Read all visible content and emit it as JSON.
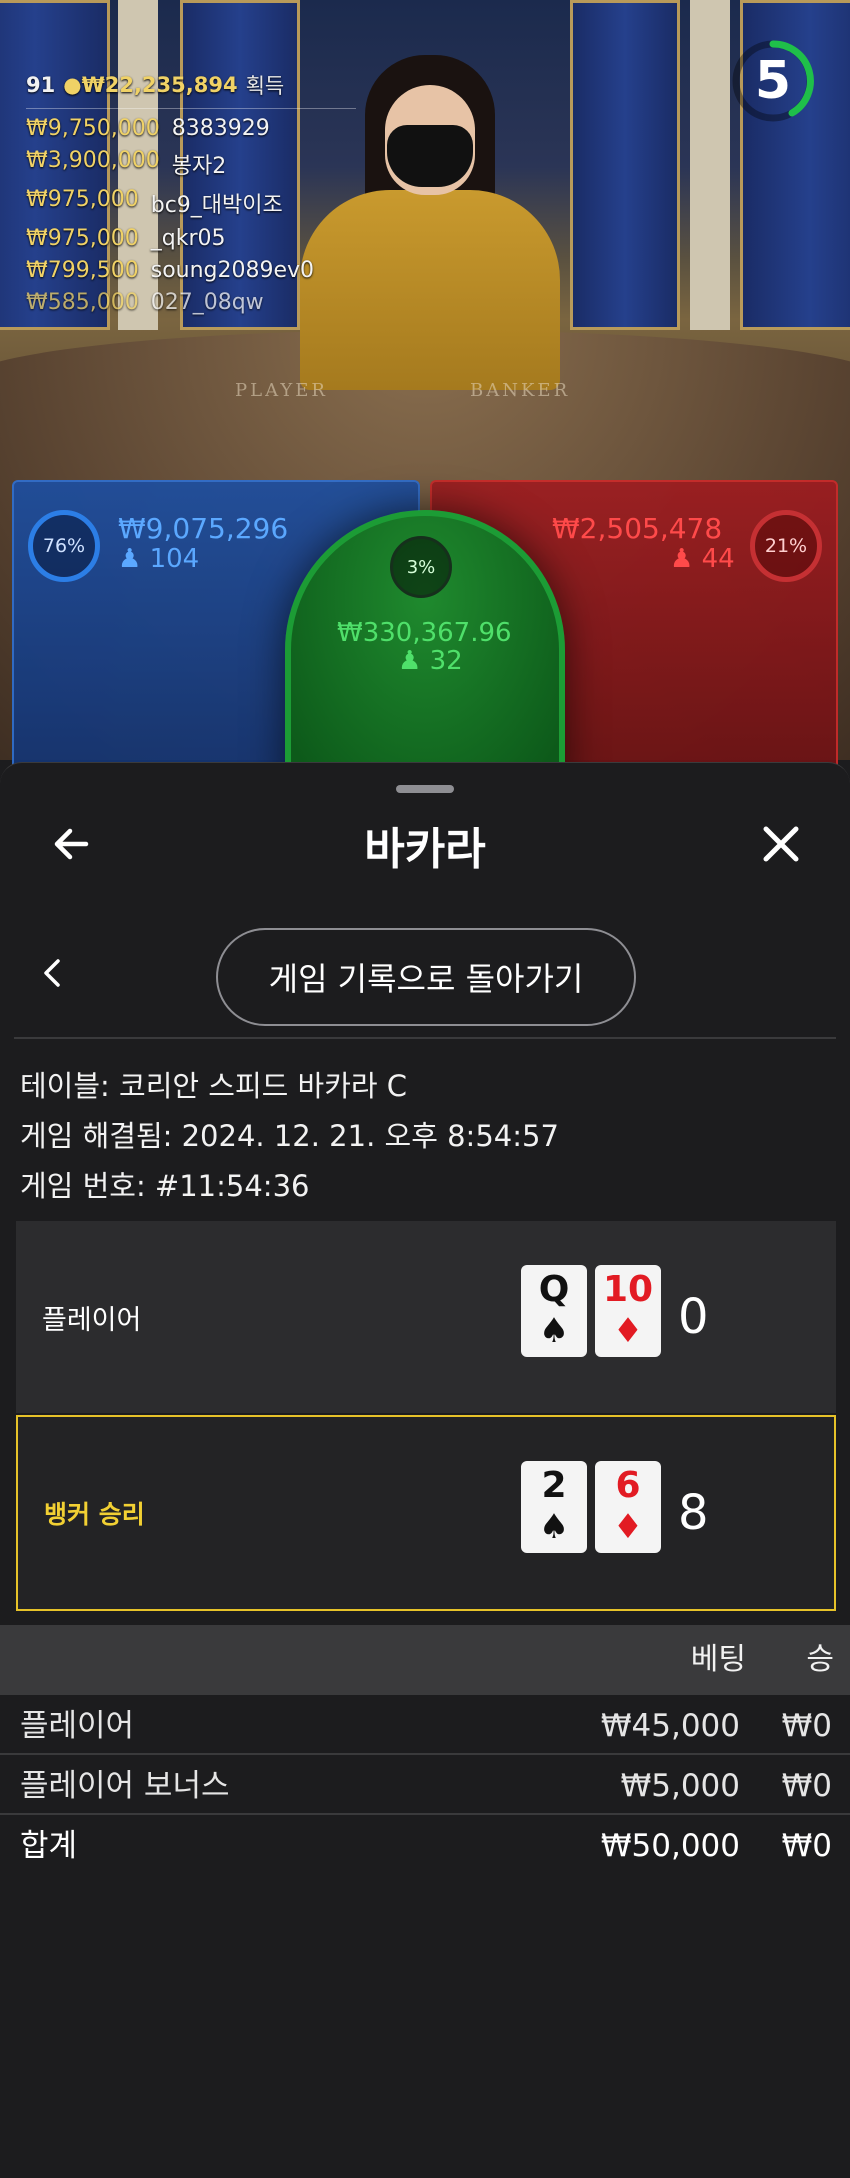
{
  "video": {
    "winners_header": {
      "count": "91",
      "total": "₩22,235,894",
      "suffix": "획득"
    },
    "winners": [
      {
        "amount": "₩9,750,000",
        "name": "8383929"
      },
      {
        "amount": "₩3,900,000",
        "name": "봉자2"
      },
      {
        "amount": "₩975,000",
        "name": "bc9_대박이조"
      },
      {
        "amount": "₩975,000",
        "name": "_qkr05"
      },
      {
        "amount": "₩799,500",
        "name": "soung2089ev0"
      },
      {
        "amount": "₩585,000",
        "name": "027_08qw"
      }
    ],
    "timer": "5",
    "felt_player": "PLAYER",
    "felt_banker": "BANKER",
    "bets": {
      "player": {
        "percent": "76%",
        "amount": "₩9,075,296",
        "players": "104",
        "color": "#2c7ee6"
      },
      "banker": {
        "percent": "21%",
        "amount": "₩2,505,478",
        "players": "44",
        "color": "#c53033"
      },
      "tie": {
        "percent": "3%",
        "amount": "₩330,367.96",
        "players": "32",
        "color": "#1c9c35"
      }
    }
  },
  "sheet": {
    "title": "바카라",
    "back_icon": "arrow-left-icon",
    "close_icon": "close-icon",
    "history_button": "게임 기록으로 돌아가기",
    "info": {
      "table": "테이블: 코리안 스피드 바카라 C",
      "resolved": "게임 해결됨: 2024. 12. 21. 오후 8:54:57",
      "game_no": "게임 번호: #11:54:36"
    },
    "hands": {
      "player": {
        "label": "플레이어",
        "score": "0",
        "cards": [
          {
            "rank": "Q",
            "suit": "♠",
            "color": "black"
          },
          {
            "rank": "10",
            "suit": "♦",
            "color": "red"
          }
        ]
      },
      "banker": {
        "label": "뱅커 승리",
        "score": "8",
        "cards": [
          {
            "rank": "2",
            "suit": "♠",
            "color": "black"
          },
          {
            "rank": "6",
            "suit": "♦",
            "color": "red"
          }
        ]
      }
    },
    "bets_table": {
      "headers": {
        "bet": "베팅",
        "win": "승"
      },
      "rows": [
        {
          "label": "플레이어",
          "bet": "₩45,000",
          "win": "₩0"
        },
        {
          "label": "플레이어 보너스",
          "bet": "₩5,000",
          "win": "₩0"
        }
      ],
      "total": {
        "label": "합계",
        "bet": "₩50,000",
        "win": "₩0"
      }
    },
    "accent_win_color": "#e6c229"
  }
}
